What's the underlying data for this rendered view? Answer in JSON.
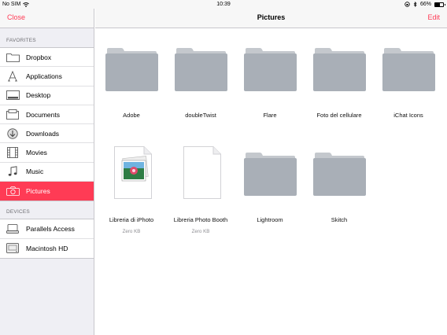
{
  "status_bar": {
    "carrier": "No SIM",
    "time": "10:39",
    "battery": "66%"
  },
  "sidebar": {
    "close_label": "Close",
    "favorites_title": "FAVORITES",
    "favorites": [
      {
        "label": "Dropbox",
        "icon": "folder-icon"
      },
      {
        "label": "Applications",
        "icon": "applications-icon"
      },
      {
        "label": "Desktop",
        "icon": "desktop-icon"
      },
      {
        "label": "Documents",
        "icon": "documents-icon"
      },
      {
        "label": "Downloads",
        "icon": "downloads-icon"
      },
      {
        "label": "Movies",
        "icon": "film-icon"
      },
      {
        "label": "Music",
        "icon": "music-icon"
      },
      {
        "label": "Pictures",
        "icon": "camera-icon",
        "active": true
      }
    ],
    "devices_title": "DEVICES",
    "devices": [
      {
        "label": "Parallels Access",
        "icon": "hard-drive-icon"
      },
      {
        "label": "Macintosh HD",
        "icon": "hard-drive-icon"
      }
    ]
  },
  "main": {
    "title": "Pictures",
    "edit_label": "Edit",
    "items": [
      {
        "name": "Adobe",
        "kind": "folder"
      },
      {
        "name": "doubleTwist",
        "kind": "folder"
      },
      {
        "name": "Flare",
        "kind": "folder"
      },
      {
        "name": "Foto del cellulare",
        "kind": "folder"
      },
      {
        "name": "iChat Icons",
        "kind": "folder"
      },
      {
        "name": "Libreria di iPhoto",
        "kind": "file",
        "size": "Zero KB"
      },
      {
        "name": "Libreria Photo Booth",
        "kind": "file",
        "size": "Zero KB"
      },
      {
        "name": "Lightroom",
        "kind": "folder"
      },
      {
        "name": "Skitch",
        "kind": "folder"
      }
    ]
  },
  "colors": {
    "accent": "#ff3b55",
    "folder": "#a9afb7",
    "folder_tab": "#c4c8cd"
  }
}
